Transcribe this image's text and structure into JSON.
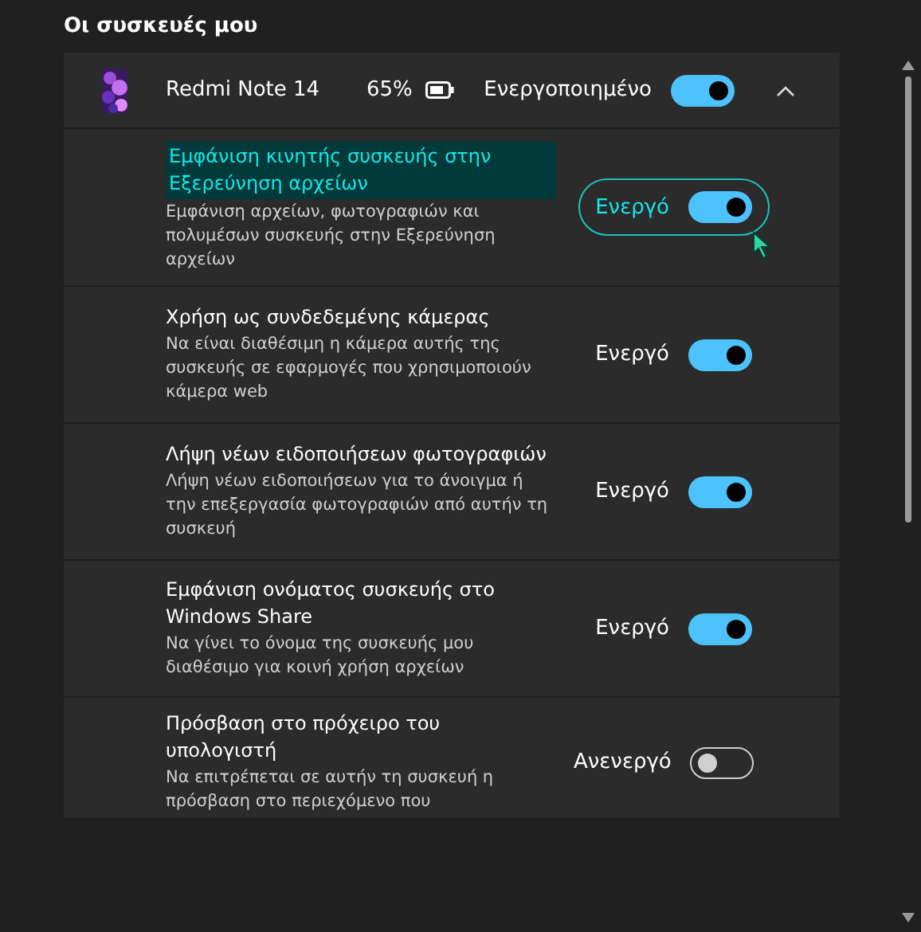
{
  "section_title": "Οι συσκευές μου",
  "device": {
    "name": "Redmi Note 14",
    "battery": "65%",
    "status": "Ενεργοποιημένο",
    "on": true,
    "expanded": true
  },
  "settings": [
    {
      "title": "Εμφάνιση κινητής συσκευής στην Εξερεύνηση αρχείων",
      "description": "Εμφάνιση αρχείων, φωτογραφιών και πολυμέσων συσκευής στην Εξερεύνηση αρχείων",
      "state": "Ενεργό",
      "on": true,
      "focused": true
    },
    {
      "title": "Χρήση ως συνδεδεμένης κάμερας",
      "description": "Να είναι διαθέσιμη η κάμερα αυτής της συσκευής σε εφαρμογές που χρησιμοποιούν κάμερα web",
      "state": "Ενεργό",
      "on": true,
      "focused": false
    },
    {
      "title": "Λήψη νέων ειδοποιήσεων φωτογραφιών",
      "description": "Λήψη νέων ειδοποιήσεων για το άνοιγμα ή την επεξεργασία φωτογραφιών από αυτήν τη συσκευή",
      "state": "Ενεργό",
      "on": true,
      "focused": false
    },
    {
      "title": "Εμφάνιση ονόματος συσκευής στο Windows Share",
      "description": "Να γίνει το όνομα της συσκευής μου διαθέσιμο για κοινή χρήση αρχείων",
      "state": "Ενεργό",
      "on": true,
      "focused": false
    },
    {
      "title": "Πρόσβαση στο πρόχειρο του υπολογιστή",
      "description": "Να επιτρέπεται σε αυτήν τη συσκευή η πρόσβαση στο περιεχόμενο που",
      "state": "Ανενεργό",
      "on": false,
      "focused": false
    }
  ]
}
